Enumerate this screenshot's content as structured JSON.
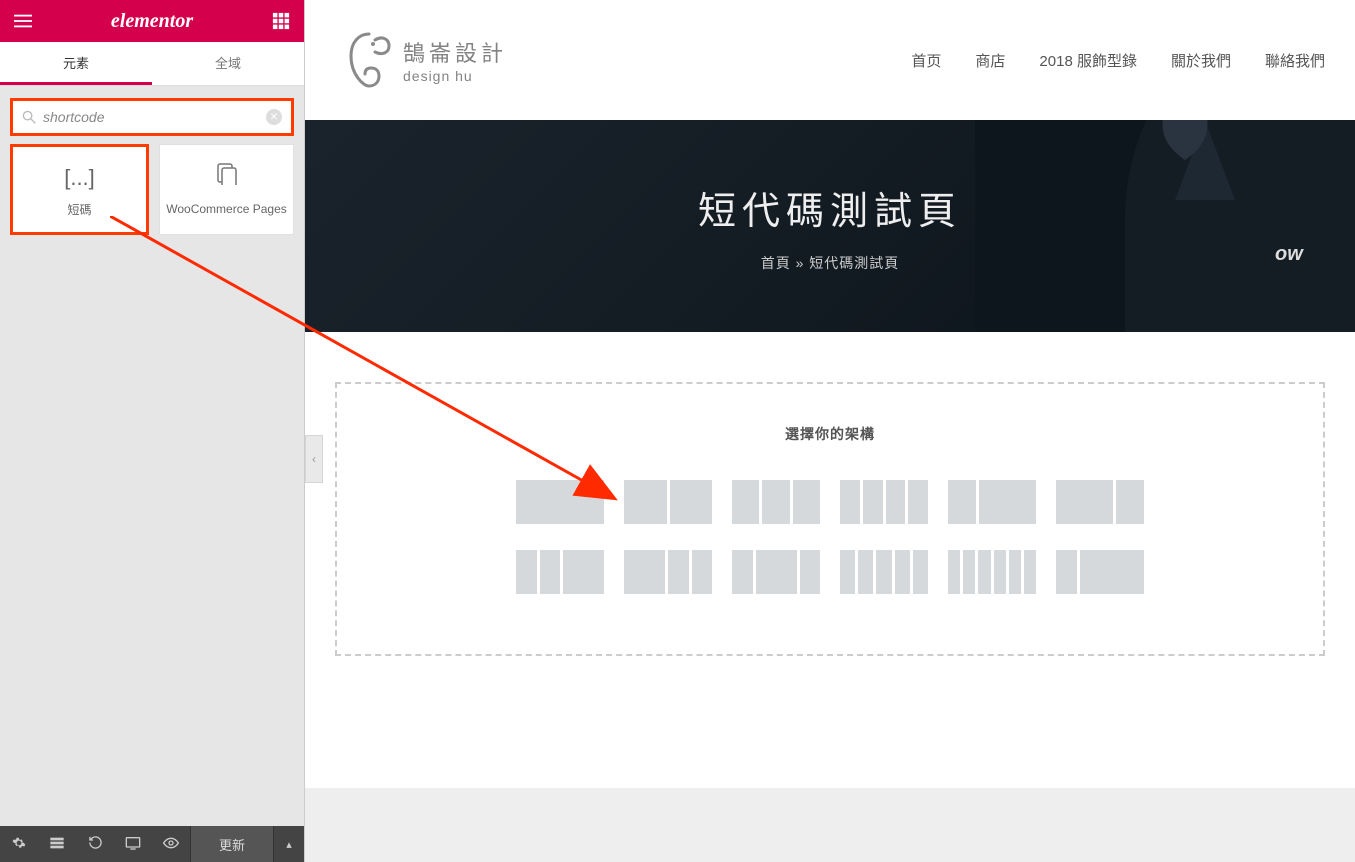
{
  "panel": {
    "brand": "elementor",
    "tabs": {
      "elements": "元素",
      "global": "全域"
    },
    "search": {
      "value": "shortcode",
      "placeholder": ""
    },
    "widgets": {
      "shortcode": {
        "icon": "[...]",
        "label": "短碼"
      },
      "woo": {
        "icon": "woo",
        "label": "WooCommerce Pages"
      }
    },
    "footer": {
      "settings": "⚙",
      "history": "↺",
      "responsive": "🖵",
      "preview": "👁",
      "update": "更新",
      "caret": "▴"
    }
  },
  "site": {
    "logo": {
      "cn": "鵠崙設計",
      "en": "design hu"
    },
    "nav": [
      "首页",
      "商店",
      "2018 服飾型錄",
      "關於我們",
      "聯絡我們"
    ],
    "hero": {
      "title": "短代碼測試頁",
      "breadcrumb_home": "首頁",
      "breadcrumb_sep": "»",
      "breadcrumb_current": "短代碼測試頁"
    },
    "drop": {
      "title": "選擇你的架構"
    }
  }
}
